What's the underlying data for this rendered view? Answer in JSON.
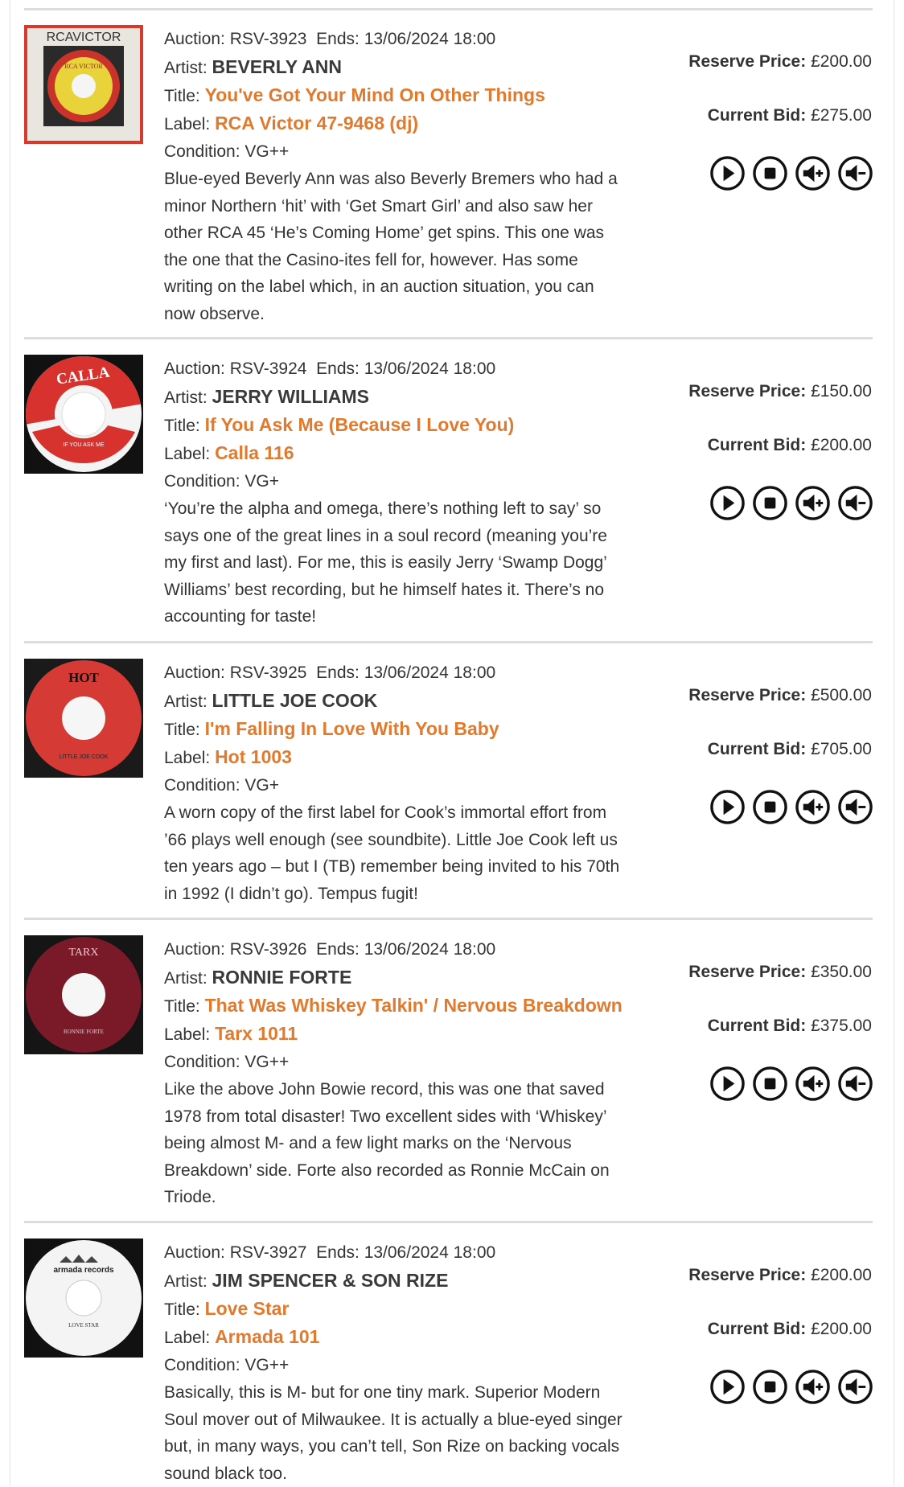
{
  "labels": {
    "auction": "Auction:",
    "ends": "Ends:",
    "artist": "Artist:",
    "title": "Title:",
    "label": "Label:",
    "condition": "Condition:",
    "reserve": "Reserve Price:",
    "current": "Current Bid:"
  },
  "controls": [
    "play-icon",
    "stop-icon",
    "volume-up-icon",
    "volume-down-icon"
  ],
  "colors": {
    "accent": "#e07a2e",
    "text": "#333333",
    "rule": "#dcdcdc"
  },
  "lots": [
    {
      "auction": "RSV-3923",
      "ends": "13/06/2024 18:00",
      "artist": "BEVERLY ANN",
      "title": "You've Got Your Mind On Other Things",
      "label": "RCA Victor 47-9468 (dj)",
      "condition": "VG++",
      "description": [
        "Blue-eyed Beverly Ann was also Beverly Bremers who had a",
        "minor Northern ‘hit’ with ‘Get Smart Girl’ and also saw her",
        "other RCA 45 ‘He’s Coming Home’ get spins. This one was",
        "the one that the Casino-ites fell for, however. Has some",
        "writing on the label which, in an auction situation, you can",
        "now observe."
      ],
      "reserve": "£200.00",
      "current": "£275.00",
      "thumb_text": [
        "RCAVICTOR",
        "RCA VICTOR"
      ]
    },
    {
      "auction": "RSV-3924",
      "ends": "13/06/2024 18:00",
      "artist": "JERRY WILLIAMS",
      "title": "If You Ask Me (Because I Love You)",
      "label": "Calla 116",
      "condition": "VG+",
      "description": [
        "‘You’re the alpha and omega, there’s nothing left to say’ so",
        "says one of the great lines in a soul record (meaning you’re",
        "my first and last). For me, this is easily Jerry ‘Swamp Dogg’",
        "Williams’ best recording, but he himself hates it. There’s no",
        "accounting for taste!"
      ],
      "reserve": "£150.00",
      "current": "£200.00",
      "thumb_text": [
        "CALLA",
        "IF YOU ASK ME"
      ]
    },
    {
      "auction": "RSV-3925",
      "ends": "13/06/2024 18:00",
      "artist": "LITTLE JOE COOK",
      "title": "I'm Falling In Love With You Baby",
      "label": "Hot 1003",
      "condition": "VG+",
      "description": [
        "A worn copy of the first label for Cook’s immortal effort from",
        "’66 plays well enough (see soundbite). Little Joe Cook left us",
        "ten years ago – but I (TB) remember being invited to his 70th",
        "in 1992 (I didn’t go). Tempus fugit!"
      ],
      "reserve": "£500.00",
      "current": "£705.00",
      "thumb_text": [
        "HOT",
        "LITTLE JOE COOK"
      ]
    },
    {
      "auction": "RSV-3926",
      "ends": "13/06/2024 18:00",
      "artist": "RONNIE FORTE",
      "title": "That Was Whiskey Talkin' / Nervous Breakdown",
      "label": "Tarx 1011",
      "condition": "VG++",
      "description": [
        "Like the above John Bowie record, this was one that saved",
        "1978 from total disaster! Two excellent sides with ‘Whiskey’",
        "being almost M- and a few light marks on the ‘Nervous",
        "Breakdown’ side. Forte also recorded as Ronnie McCain on",
        "Triode."
      ],
      "reserve": "£350.00",
      "current": "£375.00",
      "thumb_text": [
        "TARX",
        "RONNIE FORTE"
      ]
    },
    {
      "auction": "RSV-3927",
      "ends": "13/06/2024 18:00",
      "artist": "JIM SPENCER & SON RIZE",
      "title": "Love Star",
      "label": "Armada 101",
      "condition": "VG++",
      "description": [
        "Basically, this is M- but for one tiny mark. Superior Modern",
        "Soul mover out of Milwaukee. It is actually a blue-eyed singer",
        "but, in many ways, you can’t tell, Son Rize on backing vocals",
        "sound black too."
      ],
      "reserve": "£200.00",
      "current": "£200.00",
      "thumb_text": [
        "armada records",
        "LOVE STAR"
      ]
    }
  ]
}
